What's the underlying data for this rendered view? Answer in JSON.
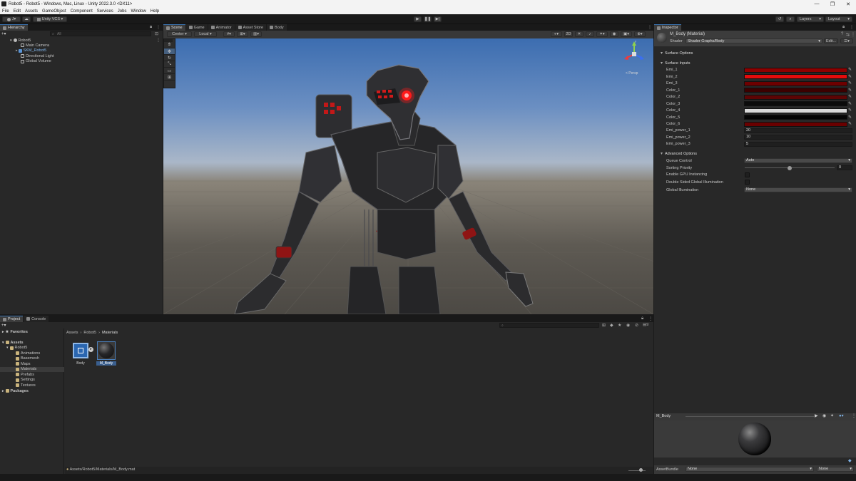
{
  "window": {
    "title": "Robot5 - Robot5 - Windows, Mac, Linux - Unity 2022.3.0 <DX11>"
  },
  "menu": [
    "File",
    "Edit",
    "Assets",
    "GameObject",
    "Component",
    "Services",
    "Jobs",
    "Window",
    "Help"
  ],
  "toolbar": {
    "account": "J",
    "vcs": "Unity VCS",
    "layers": "Layers",
    "layout": "Layout"
  },
  "hierarchy": {
    "tab": "Hierarchy",
    "search_placeholder": "All",
    "scene": "Robot5",
    "items": [
      "Main Camera",
      "SKM_Robot5",
      "Directional Light",
      "Global Volume"
    ]
  },
  "scene_tabs": [
    "Scene",
    "Game",
    "Animator",
    "Asset Store",
    "Body"
  ],
  "scene_toolbar": {
    "pivot": "Center",
    "space": "Local",
    "persp": "< Persp"
  },
  "project": {
    "tabs": [
      "Project",
      "Console"
    ],
    "favorites": "Favorites",
    "assets": "Assets",
    "robot": "Robot5",
    "folders": [
      "Animations",
      "Basemesh",
      "Maps",
      "Materials",
      "Prefabs",
      "Settings",
      "Textures"
    ],
    "packages": "Packages",
    "breadcrumb": [
      "Assets",
      "Robot5",
      "Materials"
    ],
    "files": [
      "Body",
      "M_Body"
    ],
    "path": "Assets/Robot5/Materials/M_Body.mat",
    "count": "9"
  },
  "inspector": {
    "tab": "Inspector",
    "name": "M_Body (Material)",
    "shader_label": "Shader",
    "shader": "Shader Graphs/Body",
    "edit": "Edit...",
    "surface_options": "Surface Options",
    "surface_inputs": "Surface Inputs",
    "props": [
      {
        "label": "Emi_1",
        "color": "#8e0000"
      },
      {
        "label": "Emi_2",
        "color": "#e40b0b"
      },
      {
        "label": "Emi_3",
        "color": "#6e0000"
      },
      {
        "label": "Color_1",
        "color": "#3b0000"
      },
      {
        "label": "Color_2",
        "color": "#5c0404"
      },
      {
        "label": "Color_3",
        "color": "#0c0c0c"
      },
      {
        "label": "Color_4",
        "color": "#d9d9d9"
      },
      {
        "label": "Color_5",
        "color": "#050505"
      },
      {
        "label": "Color_6",
        "color": "#6a0000"
      }
    ],
    "powers": [
      {
        "label": "Emi_power_1",
        "value": "20"
      },
      {
        "label": "Emi_power_2",
        "value": "10"
      },
      {
        "label": "Emi_power_3",
        "value": "5"
      }
    ],
    "advanced": "Advanced Options",
    "queue_label": "Queue Control",
    "queue_value": "Auto",
    "sorting_label": "Sorting Priority",
    "sorting_value": "0",
    "gpu_label": "Enable GPU Instancing",
    "dsgi_label": "Double Sided Global Illumination",
    "gi_label": "Global Illumination",
    "gi_value": "None",
    "preview_title": "M_Body",
    "assetbundle_label": "AssetBundle",
    "assetbundle_value": "None",
    "variant_value": "None"
  },
  "colors": {
    "accent": "#3a72b0",
    "eye": "#ff1a1a",
    "armor_red": "#8f1414"
  }
}
